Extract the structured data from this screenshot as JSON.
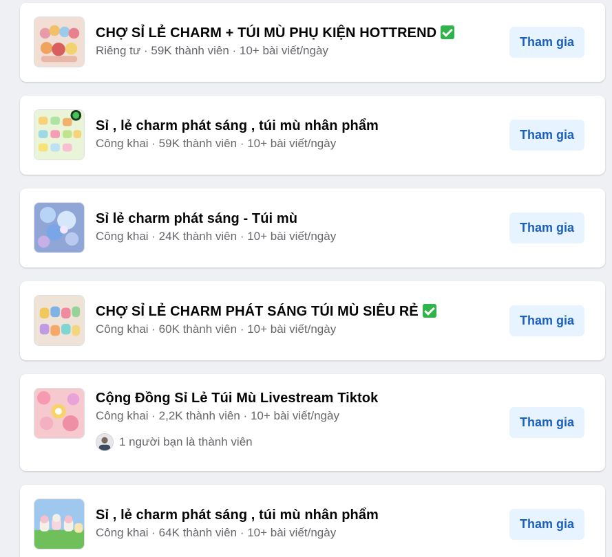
{
  "groups": [
    {
      "name": "CHỢ SỈ LẺ CHARM + TÚI MÙ PHỤ KIỆN HOTTREND",
      "verified": true,
      "privacy": "Riêng tư",
      "members": "59K thành viên",
      "activity": "10+ bài viết/ngày",
      "join_label": "Tham gia"
    },
    {
      "name": "Sỉ , lẻ charm phát sáng , túi mù nhân phẩm",
      "verified": false,
      "privacy": "Công khai",
      "members": "59K thành viên",
      "activity": "10+ bài viết/ngày",
      "join_label": "Tham gia"
    },
    {
      "name": "Sỉ lẻ charm phát sáng - Túi mù",
      "verified": false,
      "privacy": "Công khai",
      "members": "24K thành viên",
      "activity": "10+ bài viết/ngày",
      "join_label": "Tham gia"
    },
    {
      "name": "CHỢ SỈ LẺ CHARM PHÁT SÁNG TÚI MÙ SIÊU RẺ",
      "verified": true,
      "privacy": "Công khai",
      "members": "60K thành viên",
      "activity": "10+ bài viết/ngày",
      "join_label": "Tham gia"
    },
    {
      "name": "Cộng Đồng Sỉ Lẻ Túi Mù Livestream Tiktok",
      "verified": false,
      "privacy": "Công khai",
      "members": "2,2K thành viên",
      "activity": "10+ bài viết/ngày",
      "friends_text": "1 người bạn là thành viên",
      "join_label": "Tham gia"
    },
    {
      "name": "Sỉ , lẻ charm phát sáng , túi mù nhân phẩm",
      "verified": false,
      "privacy": "Công khai",
      "members": "64K thành viên",
      "activity": "10+ bài viết/ngày",
      "join_label": "Tham gia"
    }
  ],
  "separator": " · ",
  "colors": {
    "background": "#eef0f3",
    "card": "#ffffff",
    "title": "#050505",
    "meta": "#65676b",
    "button_bg": "#e7f3ff",
    "button_text": "#1b5fbf",
    "verified_check": "#2fb34a"
  },
  "icons": {
    "verified": "white-check-mark-icon"
  }
}
